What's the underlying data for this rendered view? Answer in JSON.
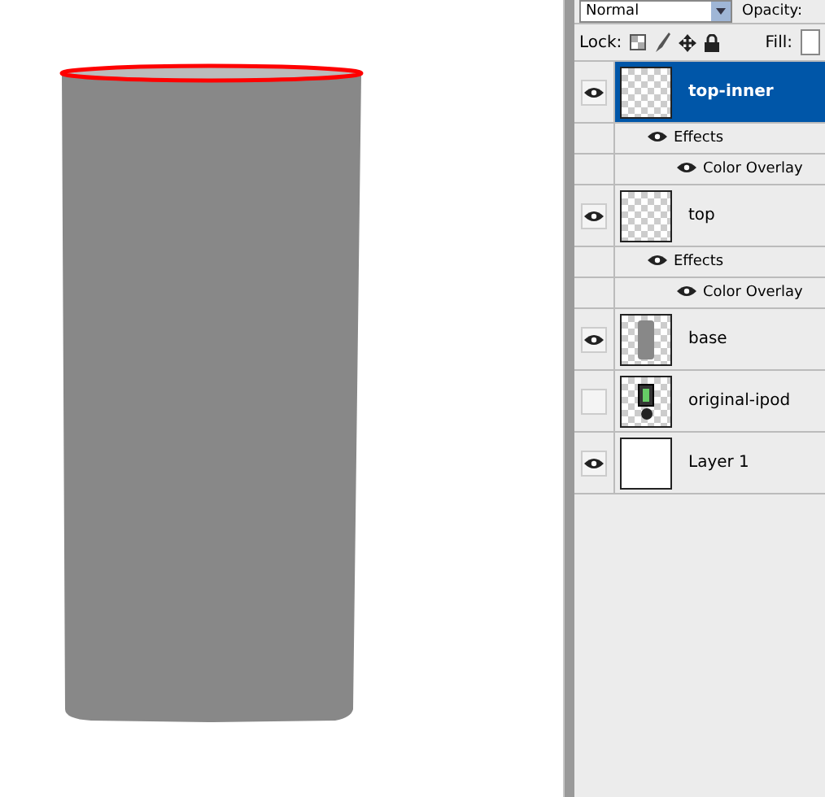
{
  "options_bar": {
    "blend_mode": "Normal",
    "opacity_label": "Opacity:"
  },
  "lock_bar": {
    "label": "Lock:",
    "fill_label": "Fill:"
  },
  "layers": [
    {
      "name": "top-inner",
      "visible": true,
      "selected": true,
      "kind": "transparent",
      "effects": {
        "label": "Effects",
        "visible": true,
        "items": [
          {
            "label": "Color Overlay",
            "visible": true
          }
        ]
      }
    },
    {
      "name": "top",
      "visible": true,
      "selected": false,
      "kind": "transparent",
      "effects": {
        "label": "Effects",
        "visible": true,
        "items": [
          {
            "label": "Color Overlay",
            "visible": true
          }
        ]
      }
    },
    {
      "name": "base",
      "visible": true,
      "selected": false,
      "kind": "shape"
    },
    {
      "name": "original-ipod",
      "visible": false,
      "selected": false,
      "kind": "device"
    },
    {
      "name": "Layer 1",
      "visible": true,
      "selected": false,
      "kind": "white"
    }
  ]
}
